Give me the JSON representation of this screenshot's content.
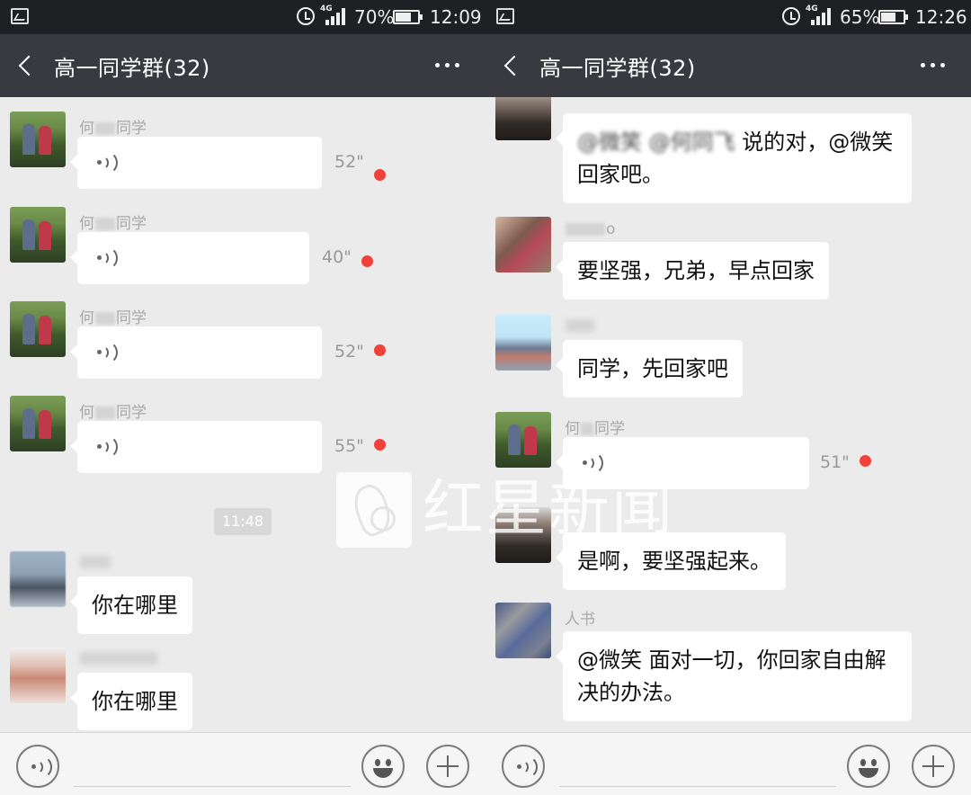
{
  "colors": {
    "status_bar": "#1f2024",
    "title_bar": "#393a3f",
    "chat_background": "#ebebeb",
    "unread_dot": "#f0423a",
    "bubble": "#ffffff"
  },
  "left": {
    "status": {
      "battery": "70%",
      "battery_level": 0.7,
      "time": "12:09",
      "network": "4G"
    },
    "title": "高一同学群(32)",
    "messages": [
      {
        "sender": "同学",
        "sender_prefix": "何",
        "type": "voice",
        "duration": "52\"",
        "unread": true
      },
      {
        "sender": "同学",
        "sender_prefix": "何",
        "type": "voice",
        "duration": "40\"",
        "unread": true
      },
      {
        "sender": "同学",
        "sender_prefix": "何",
        "type": "voice",
        "duration": "52\"",
        "unread": true
      },
      {
        "sender": "同学",
        "sender_prefix": "何",
        "type": "voice",
        "duration": "55\"",
        "unread": true
      },
      {
        "type": "text",
        "text": "你在哪里"
      },
      {
        "type": "text",
        "text": "你在哪里"
      }
    ],
    "time_label": "11:48"
  },
  "right": {
    "status": {
      "battery": "65%",
      "battery_level": 0.65,
      "time": "12:26",
      "network": "4G"
    },
    "title": "高一同学群(32)",
    "messages": [
      {
        "type": "text",
        "line1": "说的对，@微笑",
        "line2": "回家吧。"
      },
      {
        "sender": "o",
        "type": "text",
        "text": "要坚强，兄弟，早点回家"
      },
      {
        "type": "text",
        "text": "同学，先回家吧"
      },
      {
        "sender": "同学",
        "sender_prefix": "何",
        "type": "voice",
        "duration": "51\"",
        "unread": true
      },
      {
        "type": "text",
        "text": "是啊，要坚强起来。"
      },
      {
        "sender": "人书",
        "type": "text",
        "line1": "@微笑  面对一切，你回家自由解",
        "line2": "决的办法。"
      }
    ]
  },
  "watermark": {
    "text": "红星新闻"
  },
  "icons": {
    "back": "chevron-left-icon",
    "more": "more-dots-icon",
    "voice": "voice-wave-icon",
    "emoji": "emoji-face-icon",
    "plus": "plus-icon",
    "alarm": "alarm-icon",
    "signal": "signal-icon",
    "battery": "battery-icon",
    "gallery": "gallery-icon"
  }
}
